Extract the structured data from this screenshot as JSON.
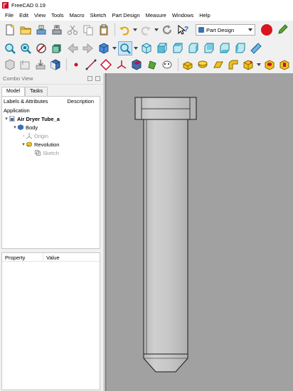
{
  "window": {
    "title": "FreeCAD 0.19"
  },
  "menu": [
    "File",
    "Edit",
    "View",
    "Tools",
    "Macro",
    "Sketch",
    "Part Design",
    "Measure",
    "Windows",
    "Help"
  ],
  "workbench": {
    "selected": "Part Design"
  },
  "combo_view": {
    "title": "Combo View",
    "tabs": [
      "Model",
      "Tasks"
    ],
    "tree_columns": [
      "Labels & Attributes",
      "Description"
    ],
    "section": "Application",
    "tree": [
      {
        "label": "Air Dryer Tube_a",
        "level": 0,
        "expanded": true,
        "icon": "document-icon",
        "style": "bold"
      },
      {
        "label": "Body",
        "level": 1,
        "expanded": true,
        "icon": "body-icon",
        "style": "normal"
      },
      {
        "label": "Origin",
        "level": 2,
        "expanded": false,
        "icon": "origin-icon",
        "style": "grey"
      },
      {
        "label": "Revolution",
        "level": 2,
        "expanded": true,
        "icon": "revolution-icon",
        "style": "normal"
      },
      {
        "label": "Sketch",
        "level": 3,
        "expanded": null,
        "icon": "sketch-icon",
        "style": "grey"
      }
    ],
    "property_columns": [
      "Property",
      "Value"
    ]
  },
  "colors": {
    "viewport_bg": "#a1a1a1",
    "model_fill": "#c4c4c4",
    "model_edge": "#1a1a1a"
  }
}
